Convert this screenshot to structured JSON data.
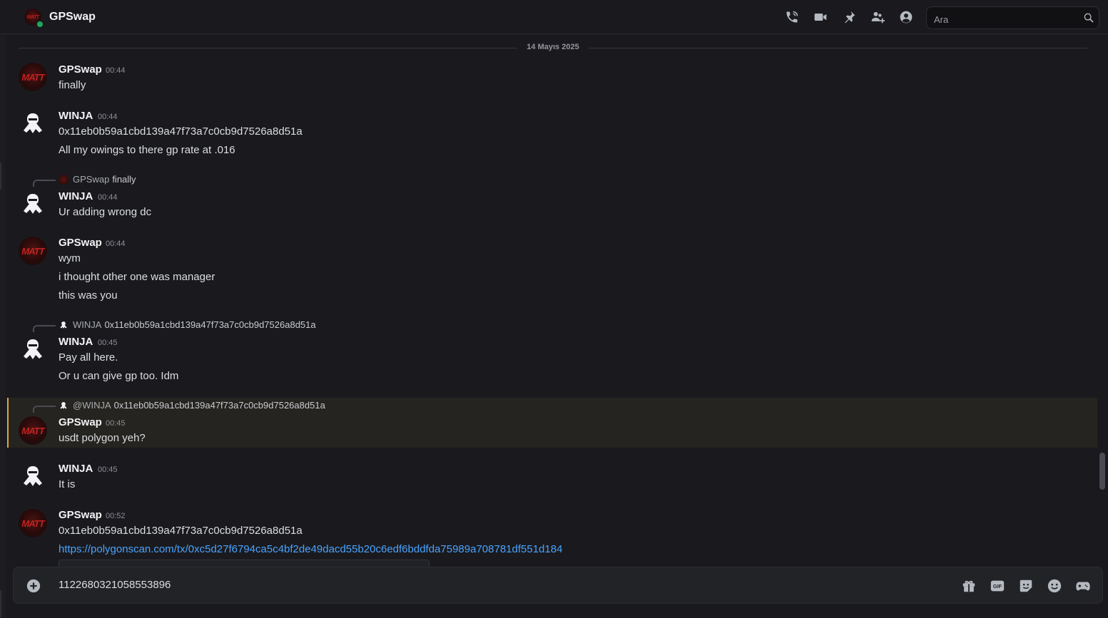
{
  "header": {
    "title": "GPSwap",
    "avatar_text": "MATT",
    "search_placeholder": "Ara"
  },
  "header_icons": [
    "phone-icon",
    "video-icon",
    "pin-icon",
    "add-friends-icon",
    "user-profile-icon",
    "search-icon"
  ],
  "date_divider": "14 Mayıs 2025",
  "messages": [
    {
      "author": "GPSwap",
      "time": "00:44",
      "avatar": "MATT",
      "lines": [
        "finally"
      ]
    },
    {
      "author": "WINJA",
      "time": "00:44",
      "lines": [
        "0x11eb0b59a1cbd139a47f73a7c0cb9d7526a8d51a",
        "All my owings to there gp rate at .016"
      ]
    },
    {
      "reply_author": "GPSwap",
      "reply_text": "finally",
      "author": "WINJA",
      "time": "00:44",
      "lines": [
        "Ur adding wrong dc"
      ]
    },
    {
      "author": "GPSwap",
      "time": "00:44",
      "avatar": "MATT",
      "lines": [
        "wym",
        "i thought other one was manager",
        "this was you"
      ]
    },
    {
      "reply_author": "WINJA",
      "reply_text": "0x11eb0b59a1cbd139a47f73a7c0cb9d7526a8d51a",
      "author": "WINJA",
      "time": "00:45",
      "lines": [
        "Pay all here.",
        "Or u can give gp too. Idm"
      ]
    },
    {
      "reply_author": "@WINJA",
      "reply_text": "0x11eb0b59a1cbd139a47f73a7c0cb9d7526a8d51a",
      "author": "GPSwap",
      "time": "00:45",
      "avatar": "MATT",
      "lines": [
        "usdt polygon yeh?"
      ],
      "highlighted": true
    },
    {
      "author": "WINJA",
      "time": "00:45",
      "lines": [
        "It is"
      ]
    },
    {
      "author": "GPSwap",
      "time": "00:52",
      "avatar": "MATT",
      "lines": [
        "0x11eb0b59a1cbd139a47f73a7c0cb9d7526a8d51a"
      ],
      "link": "https://polygonscan.com/tx/0xc5d27f6794ca5c4bf2de49dacd55b20c6edf6bddfda75989a708781df551d184"
    }
  ],
  "composer": {
    "value": "1122680321058553896",
    "icons": [
      "add-attachment-icon",
      "gift-icon",
      "gif-icon",
      "sticker-icon",
      "emoji-icon",
      "activities-icon"
    ]
  },
  "colors": {
    "accent_link": "#4aa3ff",
    "online": "#23a55a",
    "mention_highlight_bar": "#e0a83a",
    "background": "#1a1a1e"
  }
}
